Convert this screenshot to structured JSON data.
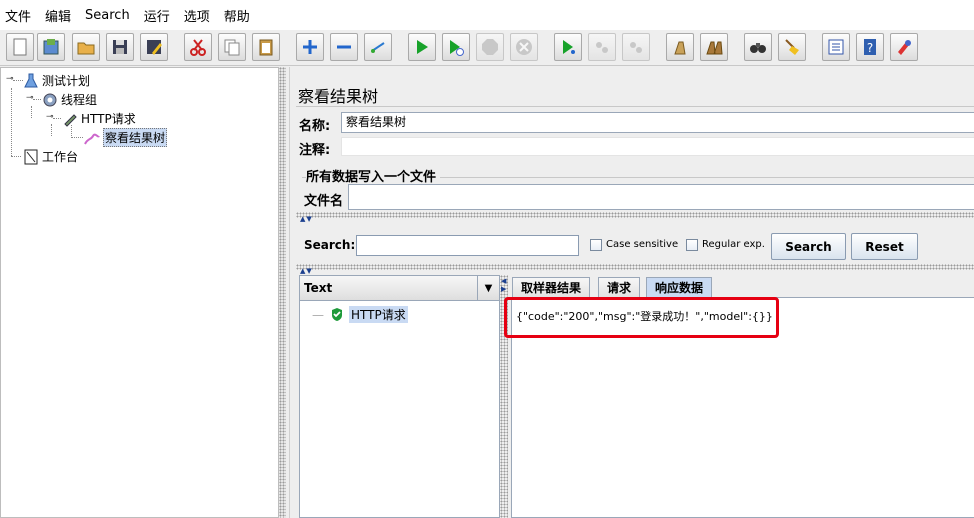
{
  "menu": [
    "文件",
    "编辑",
    "Search",
    "运行",
    "选项",
    "帮助"
  ],
  "toolbar_icons": [
    "new-icon",
    "templates-icon",
    "open-icon",
    "save-icon",
    "save-as-icon",
    "cut-icon",
    "copy-icon",
    "paste-icon",
    "expand-icon",
    "collapse-icon",
    "toggle-icon",
    "start-icon",
    "start-no-timers-icon",
    "stop-icon",
    "shutdown-icon",
    "remote-start-icon",
    "remote-stop-icon",
    "remote-shutdown-icon",
    "clear-icon",
    "clear-all-icon",
    "search-icon",
    "reset-search-icon",
    "function-helper-icon",
    "help-icon",
    "log-viewer-icon"
  ],
  "tree": {
    "test_plan": "测试计划",
    "thread_group": "线程组",
    "http_request": "HTTP请求",
    "results_tree": "察看结果树",
    "workbench": "工作台"
  },
  "panel": {
    "title": "察看结果树",
    "name_label": "名称:",
    "name_value": "察看结果树",
    "comment_label": "注释:",
    "comment_value": "",
    "file_group_title": "所有数据写入一个文件",
    "filename_label": "文件名",
    "filename_value": ""
  },
  "search": {
    "label": "Search:",
    "value": "",
    "case_sensitive_label": "Case sensitive",
    "regex_label": "Regular exp.",
    "search_button": "Search",
    "reset_button": "Reset"
  },
  "results": {
    "renderer": "Text",
    "items": [
      "HTTP请求"
    ],
    "status": "success"
  },
  "tabs": [
    "取样器结果",
    "请求",
    "响应数据"
  ],
  "active_tab": "响应数据",
  "response_text": "{\"code\":\"200\",\"msg\":\"登录成功！\",\"model\":{}}",
  "colors": {
    "highlight": "#e60012",
    "selection": "#c9daf3"
  }
}
